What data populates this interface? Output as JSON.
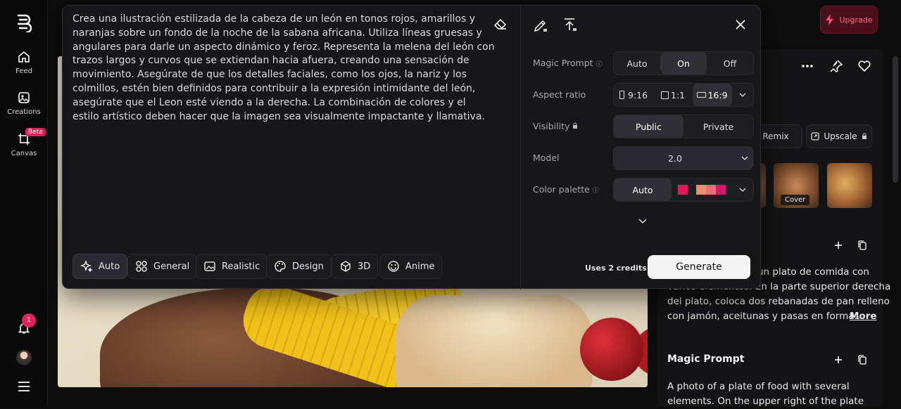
{
  "nav": {
    "items": [
      {
        "label": "Feed",
        "icon": "home-icon"
      },
      {
        "label": "Creations",
        "icon": "image-icon"
      },
      {
        "label": "Canvas",
        "icon": "canvas-icon",
        "badge": "Beta"
      }
    ],
    "notifications_count": "1"
  },
  "header": {
    "upgrade_label": "Upgrade"
  },
  "prompt": {
    "text": "Crea una ilustración estilizada de la cabeza de un león en tonos rojos, amarillos y naranjas sobre un fondo de la noche de la sabana africana. Utiliza líneas gruesas y angulares para darle un aspecto dinámico y feroz. Representa la melena del león con trazos largos y curvos que se extiendan hacia afuera, creando una sensación de movimiento. Asegúrate de que los detalles faciales, como los ojos, la nariz y los colmillos, estén bien definidos para contribuir a la expresión intimidante del león, asegúrate que el Leon esté viendo a la derecha. La combinación de colores y el estilo artístico deben hacer que la imagen sea visualmente impactante y llamativa."
  },
  "styles": [
    {
      "label": "Auto",
      "icon": "sparkle-icon",
      "active": true
    },
    {
      "label": "General",
      "icon": "grid-icon"
    },
    {
      "label": "Realistic",
      "icon": "photo-icon"
    },
    {
      "label": "Design",
      "icon": "palette-icon"
    },
    {
      "label": "3D",
      "icon": "cube-icon"
    },
    {
      "label": "Anime",
      "icon": "smile-icon"
    }
  ],
  "settings": {
    "magic_prompt": {
      "label": "Magic Prompt",
      "options": [
        "Auto",
        "On",
        "Off"
      ],
      "selected": "On"
    },
    "aspect_ratio": {
      "label": "Aspect ratio",
      "options": [
        "9:16",
        "1:1",
        "16:9"
      ],
      "selected": "16:9"
    },
    "visibility": {
      "label": "Visibility",
      "options": [
        "Public",
        "Private"
      ],
      "selected": "Public"
    },
    "model": {
      "label": "Model",
      "value": "2.0"
    },
    "color_palette": {
      "label": "Color palette",
      "value": "Auto",
      "swatches": [
        "#e0185a",
        "#e89070",
        "#e6707a",
        "#e05a80",
        "#d8186a"
      ]
    }
  },
  "credits": "Uses 2 credits",
  "generate_label": "Generate",
  "right_panel": {
    "remix_label": "Remix",
    "upscale_label": "Upscale",
    "cover_label": "Cover",
    "description_visible": "un plato de comida con",
    "description_lines": [
      "varios elementos. En la parte superior derecha",
      "del plato, coloca dos rebanadas de pan relleno",
      "con jamón, aceitunas y pasas en forma..."
    ],
    "more_label": "More",
    "magic_prompt_title": "Magic Prompt",
    "magic_prompt_text": "A photo of a plate of food with several",
    "magic_prompt_text2": "elements. On the upper right of the plate"
  },
  "colors": {
    "accent": "#e0245e",
    "upgrade_bg": "#4a0f1a",
    "panel": "#17171a"
  }
}
